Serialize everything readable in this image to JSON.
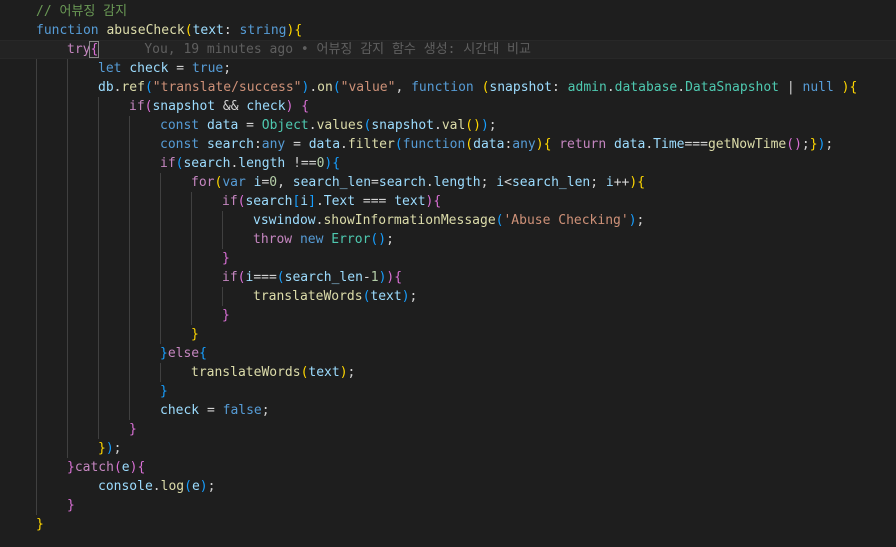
{
  "editor": {
    "colors": {
      "background": "#1e1e1e",
      "keyword": "#569cd6",
      "control": "#c586c0",
      "function": "#dcdcaa",
      "variable": "#9cdcfe",
      "type": "#4ec9b0",
      "string": "#ce9178",
      "number": "#b5cea8",
      "comment": "#6a9955",
      "bracket_level1": "#ffd700",
      "bracket_level2": "#da70d6",
      "bracket_level3": "#179fff",
      "blame": "#5f5f5f"
    },
    "blame_annotation": "You, 19 minutes ago • 어뷰징 감지 함수 생성: 시간대 비교",
    "lines": [
      [
        [
          "cmt",
          "// 어뷰징 감지"
        ]
      ],
      [
        [
          "kw",
          "function"
        ],
        [
          "pun",
          " "
        ],
        [
          "fn",
          "abuseCheck"
        ],
        [
          "b1",
          "("
        ],
        [
          "var",
          "text"
        ],
        [
          "pun",
          ": "
        ],
        [
          "kw",
          "string"
        ],
        [
          "b1",
          ")"
        ],
        [
          "b1",
          "{"
        ]
      ],
      [
        [
          "ctl",
          "try"
        ],
        [
          "b2",
          "{"
        ]
      ],
      [
        [
          "kw",
          "let"
        ],
        [
          "pun",
          " "
        ],
        [
          "var",
          "check"
        ],
        [
          "pun",
          " = "
        ],
        [
          "kw",
          "true"
        ],
        [
          "pun",
          ";"
        ]
      ],
      [
        [
          "var",
          "db"
        ],
        [
          "pun",
          "."
        ],
        [
          "fn",
          "ref"
        ],
        [
          "b3",
          "("
        ],
        [
          "str",
          "\"translate/success\""
        ],
        [
          "b3",
          ")"
        ],
        [
          "pun",
          "."
        ],
        [
          "fn",
          "on"
        ],
        [
          "b3",
          "("
        ],
        [
          "str",
          "\"value\""
        ],
        [
          "pun",
          ", "
        ],
        [
          "kw",
          "function"
        ],
        [
          "pun",
          " "
        ],
        [
          "b1",
          "("
        ],
        [
          "var",
          "snapshot"
        ],
        [
          "pun",
          ": "
        ],
        [
          "typ",
          "admin"
        ],
        [
          "pun",
          "."
        ],
        [
          "typ",
          "database"
        ],
        [
          "pun",
          "."
        ],
        [
          "typ",
          "DataSnapshot"
        ],
        [
          "pun",
          " | "
        ],
        [
          "kw",
          "null"
        ],
        [
          "pun",
          " "
        ],
        [
          "b1",
          ")"
        ],
        [
          "b1",
          "{"
        ]
      ],
      [
        [
          "ctl",
          "if"
        ],
        [
          "b2",
          "("
        ],
        [
          "var",
          "snapshot"
        ],
        [
          "pun",
          " && "
        ],
        [
          "var",
          "check"
        ],
        [
          "b2",
          ")"
        ],
        [
          "pun",
          " "
        ],
        [
          "b2",
          "{"
        ]
      ],
      [
        [
          "kw",
          "const"
        ],
        [
          "pun",
          " "
        ],
        [
          "var",
          "data"
        ],
        [
          "pun",
          " = "
        ],
        [
          "typ",
          "Object"
        ],
        [
          "pun",
          "."
        ],
        [
          "fn",
          "values"
        ],
        [
          "b3",
          "("
        ],
        [
          "var",
          "snapshot"
        ],
        [
          "pun",
          "."
        ],
        [
          "fn",
          "val"
        ],
        [
          "b1",
          "()"
        ],
        [
          "b3",
          ")"
        ],
        [
          "pun",
          ";"
        ]
      ],
      [
        [
          "kw",
          "const"
        ],
        [
          "pun",
          " "
        ],
        [
          "var",
          "search"
        ],
        [
          "pun",
          ":"
        ],
        [
          "kw",
          "any"
        ],
        [
          "pun",
          " = "
        ],
        [
          "var",
          "data"
        ],
        [
          "pun",
          "."
        ],
        [
          "fn",
          "filter"
        ],
        [
          "b3",
          "("
        ],
        [
          "kw",
          "function"
        ],
        [
          "b1",
          "("
        ],
        [
          "var",
          "data"
        ],
        [
          "pun",
          ":"
        ],
        [
          "kw",
          "any"
        ],
        [
          "b1",
          ")"
        ],
        [
          "b1",
          "{"
        ],
        [
          "pun",
          " "
        ],
        [
          "ctl",
          "return"
        ],
        [
          "pun",
          " "
        ],
        [
          "var",
          "data"
        ],
        [
          "pun",
          "."
        ],
        [
          "var",
          "Time"
        ],
        [
          "pun",
          "==="
        ],
        [
          "fn",
          "getNowTime"
        ],
        [
          "b2",
          "()"
        ],
        [
          "pun",
          ";"
        ],
        [
          "b1",
          "}"
        ],
        [
          "b3",
          ")"
        ],
        [
          "pun",
          ";"
        ]
      ],
      [
        [
          "ctl",
          "if"
        ],
        [
          "b3",
          "("
        ],
        [
          "var",
          "search"
        ],
        [
          "pun",
          "."
        ],
        [
          "var",
          "length"
        ],
        [
          "pun",
          " !=="
        ],
        [
          "num",
          "0"
        ],
        [
          "b3",
          ")"
        ],
        [
          "b3",
          "{"
        ]
      ],
      [
        [
          "ctl",
          "for"
        ],
        [
          "b1",
          "("
        ],
        [
          "kw",
          "var"
        ],
        [
          "pun",
          " "
        ],
        [
          "var",
          "i"
        ],
        [
          "pun",
          "="
        ],
        [
          "num",
          "0"
        ],
        [
          "pun",
          ", "
        ],
        [
          "var",
          "search_len"
        ],
        [
          "pun",
          "="
        ],
        [
          "var",
          "search"
        ],
        [
          "pun",
          "."
        ],
        [
          "var",
          "length"
        ],
        [
          "pun",
          "; "
        ],
        [
          "var",
          "i"
        ],
        [
          "pun",
          "<"
        ],
        [
          "var",
          "search_len"
        ],
        [
          "pun",
          "; "
        ],
        [
          "var",
          "i"
        ],
        [
          "pun",
          "++"
        ],
        [
          "b1",
          ")"
        ],
        [
          "b1",
          "{"
        ]
      ],
      [
        [
          "ctl",
          "if"
        ],
        [
          "b2",
          "("
        ],
        [
          "var",
          "search"
        ],
        [
          "b3",
          "["
        ],
        [
          "var",
          "i"
        ],
        [
          "b3",
          "]"
        ],
        [
          "pun",
          "."
        ],
        [
          "var",
          "Text"
        ],
        [
          "pun",
          " === "
        ],
        [
          "var",
          "text"
        ],
        [
          "b2",
          ")"
        ],
        [
          "b2",
          "{"
        ]
      ],
      [
        [
          "var",
          "vswindow"
        ],
        [
          "pun",
          "."
        ],
        [
          "fn",
          "showInformationMessage"
        ],
        [
          "b3",
          "("
        ],
        [
          "str",
          "'Abuse Checking'"
        ],
        [
          "b3",
          ")"
        ],
        [
          "pun",
          ";"
        ]
      ],
      [
        [
          "ctl",
          "throw"
        ],
        [
          "pun",
          " "
        ],
        [
          "kw",
          "new"
        ],
        [
          "pun",
          " "
        ],
        [
          "typ",
          "Error"
        ],
        [
          "b3",
          "()"
        ],
        [
          "pun",
          ";"
        ]
      ],
      [
        [
          "b2",
          "}"
        ]
      ],
      [
        [
          "ctl",
          "if"
        ],
        [
          "b2",
          "("
        ],
        [
          "var",
          "i"
        ],
        [
          "pun",
          "==="
        ],
        [
          "b3",
          "("
        ],
        [
          "var",
          "search_len"
        ],
        [
          "pun",
          "-"
        ],
        [
          "num",
          "1"
        ],
        [
          "b3",
          ")"
        ],
        [
          "b2",
          ")"
        ],
        [
          "b2",
          "{"
        ]
      ],
      [
        [
          "fn",
          "translateWords"
        ],
        [
          "b3",
          "("
        ],
        [
          "var",
          "text"
        ],
        [
          "b3",
          ")"
        ],
        [
          "pun",
          ";"
        ]
      ],
      [
        [
          "b2",
          "}"
        ]
      ],
      [
        [
          "b1",
          "}"
        ]
      ],
      [
        [
          "b3",
          "}"
        ],
        [
          "ctl",
          "else"
        ],
        [
          "b3",
          "{"
        ]
      ],
      [
        [
          "fn",
          "translateWords"
        ],
        [
          "b1",
          "("
        ],
        [
          "var",
          "text"
        ],
        [
          "b1",
          ")"
        ],
        [
          "pun",
          ";"
        ]
      ],
      [
        [
          "b3",
          "}"
        ]
      ],
      [
        [
          "var",
          "check"
        ],
        [
          "pun",
          " = "
        ],
        [
          "kw",
          "false"
        ],
        [
          "pun",
          ";"
        ]
      ],
      [
        [
          "b2",
          "}"
        ]
      ],
      [
        [
          "b1",
          "}"
        ],
        [
          "b3",
          ")"
        ],
        [
          "pun",
          ";"
        ]
      ],
      [
        [
          "b2",
          "}"
        ],
        [
          "ctl",
          "catch"
        ],
        [
          "b2",
          "("
        ],
        [
          "var",
          "e"
        ],
        [
          "b2",
          ")"
        ],
        [
          "b2",
          "{"
        ]
      ],
      [
        [
          "var",
          "console"
        ],
        [
          "pun",
          "."
        ],
        [
          "fn",
          "log"
        ],
        [
          "b3",
          "("
        ],
        [
          "var",
          "e"
        ],
        [
          "b3",
          ")"
        ],
        [
          "pun",
          ";"
        ]
      ],
      [
        [
          "b2",
          "}"
        ]
      ],
      [
        [
          "b1",
          "}"
        ]
      ]
    ]
  }
}
